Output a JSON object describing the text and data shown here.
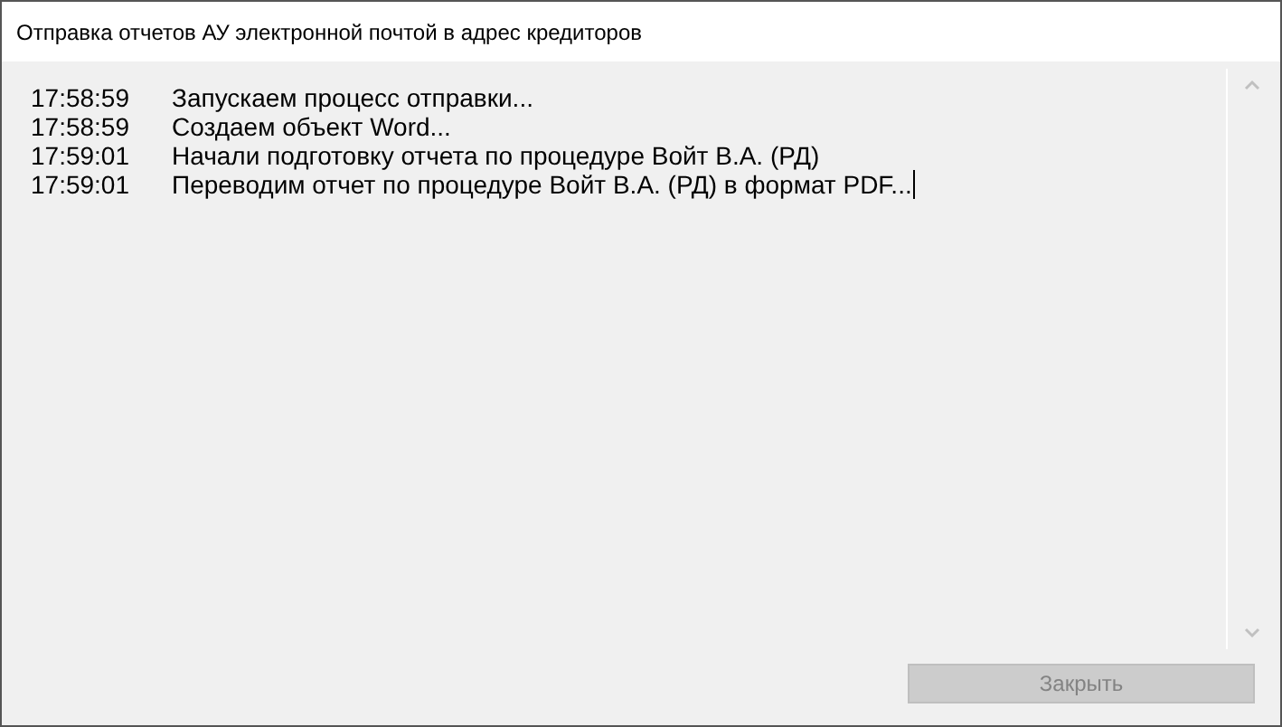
{
  "window": {
    "title": "Отправка отчетов АУ электронной почтой в адрес кредиторов"
  },
  "log": [
    {
      "time": "17:58:59",
      "message": "Запускаем процесс отправки..."
    },
    {
      "time": "17:58:59",
      "message": "Создаем объект Word..."
    },
    {
      "time": "17:59:01",
      "message": "Начали подготовку отчета по процедуре Войт В.А. (РД)"
    },
    {
      "time": "17:59:01",
      "message": "Переводим отчет по процедуре Войт В.А. (РД) в формат PDF..."
    }
  ],
  "close_button": {
    "label": "Закрыть",
    "disabled": true
  }
}
